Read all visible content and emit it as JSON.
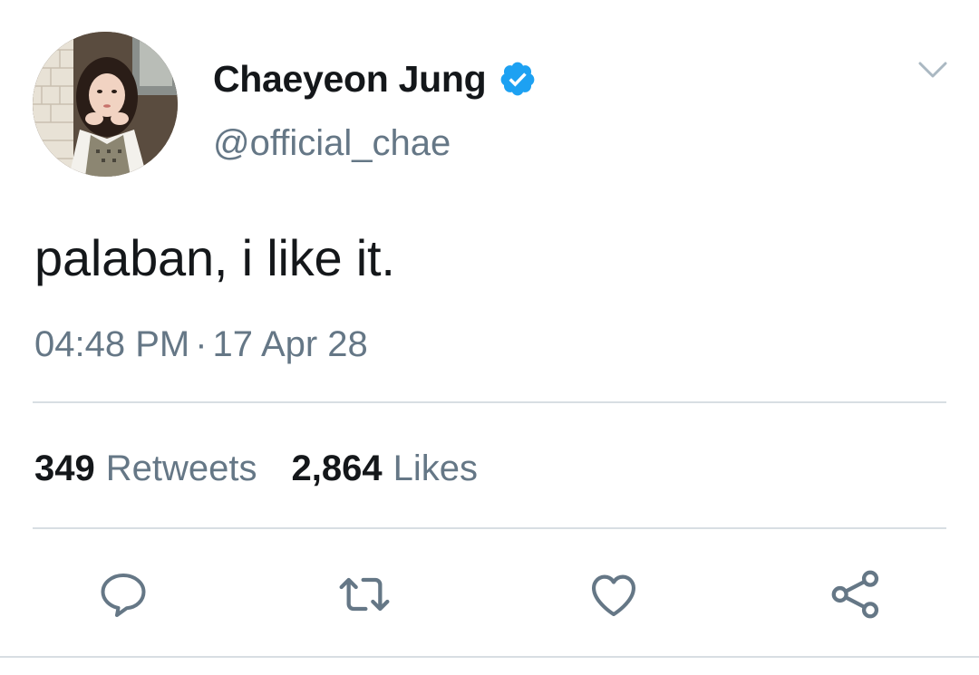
{
  "author": {
    "display_name": "Chaeyeon Jung",
    "handle": "@official_chae",
    "verified": true,
    "avatar_icon": "profile-photo"
  },
  "tweet": {
    "text": "palaban, i like it.",
    "time": "04:48 PM",
    "separator": "·",
    "date": "17 Apr 28"
  },
  "stats": {
    "retweets_count": "349",
    "retweets_label": "Retweets",
    "likes_count": "2,864",
    "likes_label": "Likes"
  },
  "actions": {
    "reply_icon": "reply-icon",
    "retweet_icon": "retweet-icon",
    "like_icon": "heart-icon",
    "share_icon": "share-icon"
  },
  "colors": {
    "text_primary": "#14171a",
    "text_secondary": "#657786",
    "verified_blue": "#1da1f2",
    "divider": "#d8dee3"
  }
}
